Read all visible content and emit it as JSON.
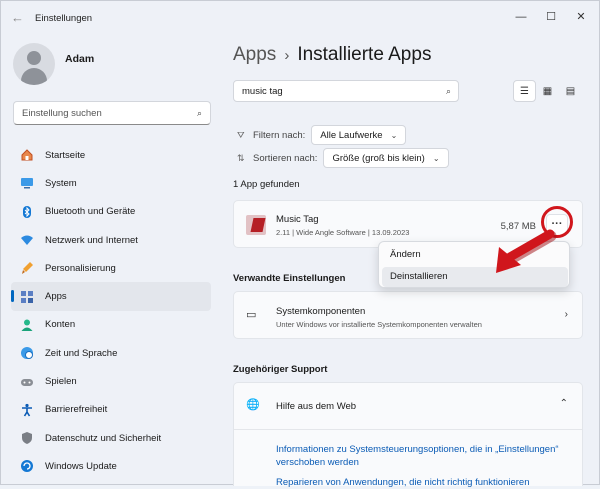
{
  "window": {
    "title": "Einstellungen",
    "controls": {
      "minimize": "—",
      "maximize": "☐",
      "close": "✕"
    }
  },
  "user": {
    "name": "Adam"
  },
  "sidebar": {
    "search_placeholder": "Einstellung suchen",
    "items": [
      {
        "label": "Startseite",
        "icon": "home-icon",
        "color": "#c24e20"
      },
      {
        "label": "System",
        "icon": "monitor-icon",
        "color": "#0078d4"
      },
      {
        "label": "Bluetooth und Geräte",
        "icon": "bluetooth-icon",
        "color": "#0078d4"
      },
      {
        "label": "Netzwerk und Internet",
        "icon": "wifi-icon",
        "color": "#0078d4"
      },
      {
        "label": "Personalisierung",
        "icon": "brush-icon",
        "color": "#e07a1f"
      },
      {
        "label": "Apps",
        "icon": "apps-icon",
        "color": "#3a63a8",
        "active": true
      },
      {
        "label": "Konten",
        "icon": "person-icon",
        "color": "#1aa37a"
      },
      {
        "label": "Zeit und Sprache",
        "icon": "globe-clock-icon",
        "color": "#0078d4"
      },
      {
        "label": "Spielen",
        "icon": "gamepad-icon",
        "color": "#777"
      },
      {
        "label": "Barrierefreiheit",
        "icon": "accessibility-icon",
        "color": "#0a5bb5"
      },
      {
        "label": "Datenschutz und Sicherheit",
        "icon": "shield-icon",
        "color": "#6b6f76"
      },
      {
        "label": "Windows Update",
        "icon": "update-icon",
        "color": "#0078d4"
      }
    ]
  },
  "main": {
    "breadcrumb": {
      "parent": "Apps",
      "sep": "›",
      "current": "Installierte Apps"
    },
    "search_value": "music tag",
    "filter": {
      "label": "Filtern nach:",
      "value": "Alle Laufwerke"
    },
    "sort": {
      "label": "Sortieren nach:",
      "value": "Größe (groß bis klein)"
    },
    "found": "1 App gefunden",
    "app": {
      "name": "Music Tag",
      "meta": "2.11  |  Wide Angle Software  |  13.09.2023",
      "size": "5,87 MB",
      "more": "···"
    },
    "context_menu": {
      "items": [
        "Ändern",
        "Deinstallieren"
      ]
    },
    "related": {
      "heading": "Verwandte Einstellungen",
      "title": "Systemkomponenten",
      "subtitle": "Unter Windows vor installierte Systemkomponenten verwalten"
    },
    "support": {
      "heading": "Zugehöriger Support",
      "title": "Hilfe aus dem Web",
      "link1": "Informationen zu Systemsteuerungsoptionen, die in „Einstellungen“ verschoben werden",
      "link2": "Reparieren von Anwendungen, die nicht richtig funktionieren"
    }
  },
  "colors": {
    "accent": "#0067c0",
    "annotation": "#d0161c"
  }
}
